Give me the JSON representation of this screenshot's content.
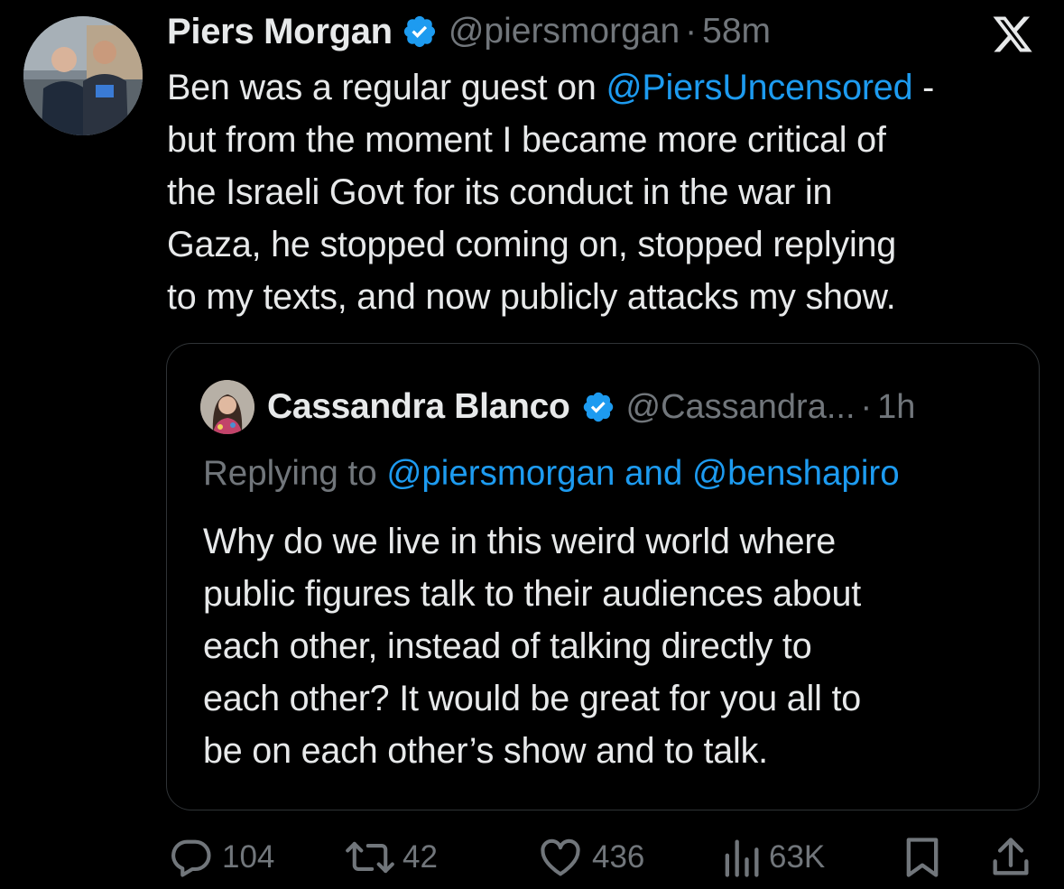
{
  "author": {
    "name": "Piers Morgan",
    "handle": "@piersmorgan",
    "separator": "·",
    "time": "58m",
    "verified_color": "#1d9bf0"
  },
  "tweet_lines": [
    {
      "pre": "Ben was a regular guest on ",
      "mention": "@PiersUncensored",
      "post": " -"
    },
    {
      "text": "but from the moment I became more critical of"
    },
    {
      "text": "the Israeli Govt for its conduct in the war in"
    },
    {
      "text": "Gaza, he stopped coming on, stopped replying"
    },
    {
      "text": "to my texts, and now publicly attacks my show."
    }
  ],
  "quote": {
    "name": "Cassandra Blanco",
    "handle": "@Cassandra...",
    "separator": "·",
    "time": "1h",
    "replying_prefix": "Replying to ",
    "replying_mention_1": "@piersmorgan",
    "replying_and": " and ",
    "replying_mention_2": "@benshapiro",
    "lines": [
      "Why do we live in this weird world where",
      "public figures talk to their audiences about",
      "each other, instead of talking directly to",
      "each other? It would be great for you all to",
      "be on each other’s show and to talk."
    ]
  },
  "actions": {
    "replies": "104",
    "reposts": "42",
    "likes": "436",
    "views": "63K"
  },
  "icons": [
    "x-logo-icon",
    "verified-badge-icon",
    "reply-icon",
    "repost-icon",
    "like-icon",
    "views-icon",
    "bookmark-icon",
    "share-icon"
  ],
  "colors": {
    "background": "#000000",
    "text": "#e7e9ea",
    "muted": "#71767b",
    "link": "#1d9bf0",
    "border": "#2f3336"
  }
}
